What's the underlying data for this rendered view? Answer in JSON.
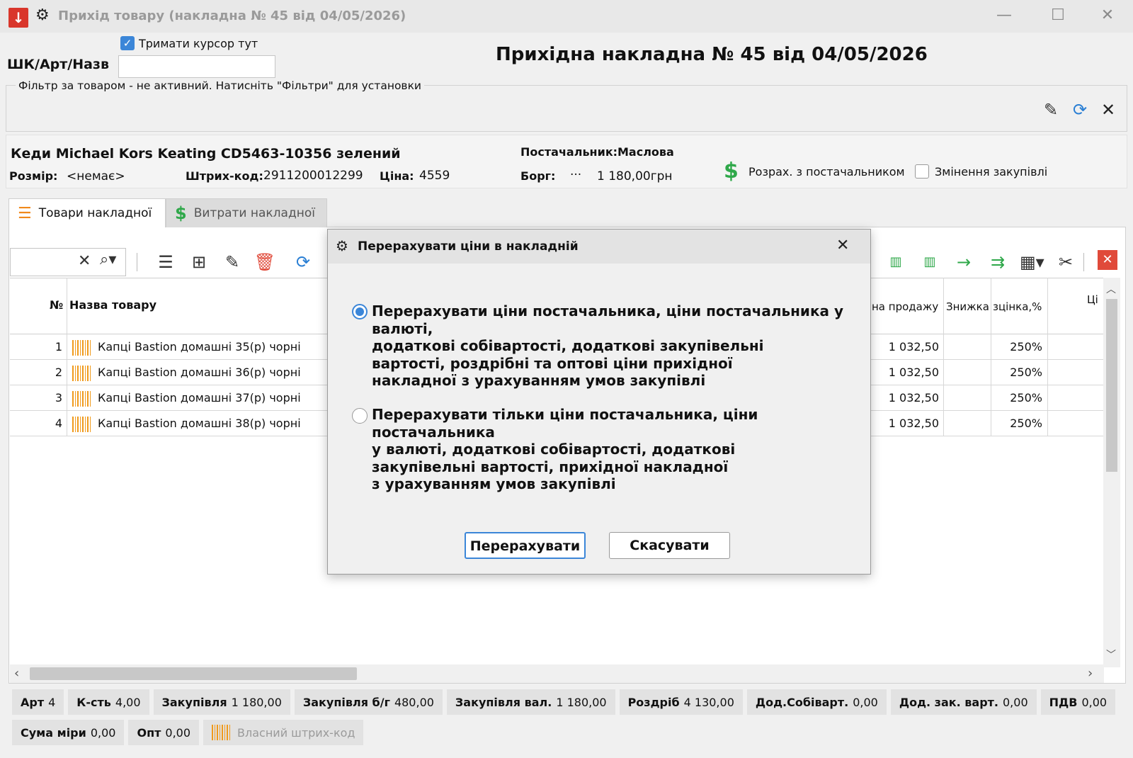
{
  "window": {
    "title": "Прихід товару (накладна № 45 від 04/05/2026)",
    "minimize": "—",
    "maximize": "☐",
    "close": "✕"
  },
  "header": {
    "keep_cursor": "Тримати курсор тут",
    "keep_cursor_checked": true,
    "sku_label": "ШК/Арт/Назв",
    "sku_value": "",
    "doc_title": "Прихідна накладна № 45 від 04/05/2026",
    "filter_legend": "Фільтр за товаром - не активний. Натисніть \"Фільтри\" для установки"
  },
  "product": {
    "name": "Кеди Michael Kors Keating CD5463-10356 зелений",
    "size_label": "Розмір:",
    "size_value": "<немає>",
    "barcode_label": "Штрих-код:",
    "barcode_value": "2911200012299",
    "price_label": "Ціна:",
    "price_value": "4559",
    "supplier_label": "Постачальник:",
    "supplier_value": "Маслова",
    "debt_label": "Борг:",
    "debt_dots": "···",
    "debt_value": "1 180,00грн",
    "settle_label": "Розрах. з постачальником",
    "change_purchase_label": "Змінення закупівлі",
    "change_purchase_checked": false
  },
  "tabs": [
    {
      "label": "Товари накладної",
      "active": true
    },
    {
      "label": "Витрати накладної",
      "active": false
    }
  ],
  "table": {
    "columns": {
      "num": "№",
      "name": "Назва товару",
      "sale_price": "на продажу",
      "discount": "Знижка",
      "markup": "зцінка,%",
      "price": "Ці"
    },
    "rows": [
      {
        "num": "1",
        "name": "Капці Bastion домашні 35(р) чорні",
        "sale_price": "1 032,50",
        "discount": "",
        "markup": "250%"
      },
      {
        "num": "2",
        "name": "Капці Bastion домашні 36(р) чорні",
        "sale_price": "1 032,50",
        "discount": "",
        "markup": "250%"
      },
      {
        "num": "3",
        "name": "Капці Bastion домашні 37(р) чорні",
        "sale_price": "1 032,50",
        "discount": "",
        "markup": "250%"
      },
      {
        "num": "4",
        "name": "Капці Bastion домашні 38(р) чорні",
        "sale_price": "1 032,50",
        "discount": "",
        "markup": "250%"
      }
    ]
  },
  "summary": {
    "row1": [
      {
        "label": "Арт",
        "value": "4"
      },
      {
        "label": "К-сть",
        "value": "4,00"
      },
      {
        "label": "Закупівля",
        "value": "1 180,00"
      },
      {
        "label": "Закупівля б/г",
        "value": "480,00"
      },
      {
        "label": "Закупівля вал.",
        "value": "1 180,00"
      },
      {
        "label": "Роздріб",
        "value": "4 130,00"
      },
      {
        "label": "Дод.Собіварт.",
        "value": "0,00"
      },
      {
        "label": "Дод. зак. варт.",
        "value": "0,00"
      },
      {
        "label": "ПДВ",
        "value": "0,00"
      }
    ],
    "row2": [
      {
        "label": "Сума міри",
        "value": "0,00"
      },
      {
        "label": "Опт",
        "value": "0,00"
      }
    ],
    "own_barcode": "Власний штрих-код"
  },
  "dialog": {
    "title": "Перерахувати ціни в накладній",
    "options": [
      {
        "selected": true,
        "lines": [
          "Перерахувати ціни постачальника, ціни постачальника у валюті,",
          "додаткові собівартості, додаткові закупівельні",
          "вартості, роздрібні та оптові ціни прихідної",
          "накладної з урахуванням умов закупівлі"
        ]
      },
      {
        "selected": false,
        "lines": [
          "Перерахувати тільки ціни постачальника, ціни постачальника",
          "у валюті, додаткові собівартості, додаткові",
          "закупівельні вартості, прихідної накладної",
          "з урахуванням умов закупівлі"
        ]
      }
    ],
    "ok_label": "Перерахувати",
    "cancel_label": "Скасувати"
  },
  "colors": {
    "accent": "#3b86d8",
    "green": "#2fa84a",
    "red": "#d9362b",
    "barcode_orange": "#f09a1c"
  }
}
